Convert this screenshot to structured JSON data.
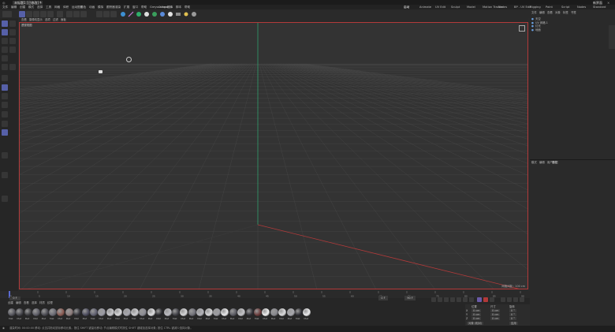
{
  "titlebar": {
    "logo": "◎",
    "doc_title": "未标题1 [已修改] *",
    "layout": "新界面"
  },
  "menu": [
    "文件",
    "编辑",
    "创建",
    "模式",
    "选择",
    "工具",
    "网格",
    "体积",
    "运动图形",
    "角色",
    "动画",
    "模拟",
    "跟踪器",
    "渲染",
    "扩展",
    "窗口",
    "帮助",
    "Greyscalegorilla",
    "Octane",
    "插件",
    "脚本",
    "帮助"
  ],
  "workspaces": [
    "启动",
    "Animate",
    "UV Edit",
    "Sculpt",
    "Model",
    "Motion Tracker",
    "Nodes",
    "BP - UV Edit",
    "Rigging",
    "Paint",
    "Script",
    "Nodes",
    "Standard"
  ],
  "viewport": {
    "name": "透视视图",
    "menu": [
      "查看",
      "摄像机",
      "显示",
      "选项",
      "过滤",
      "面板"
    ],
    "corner_text": "网格间距 : 100 cm",
    "colors": {
      "border": "#b23a3a",
      "y_axis": "#2f9e6c",
      "x_axis": "#b23a3a",
      "grid": "#4a4a4a"
    }
  },
  "object_manager": {
    "menu": [
      "文件",
      "编辑",
      "查看",
      "对象",
      "标签",
      "书签"
    ],
    "objects": [
      "天空",
      "UV 网格.1",
      "灯光",
      "地面"
    ]
  },
  "attributes": {
    "menu": [
      "模式",
      "编辑",
      "用户数据"
    ],
    "title": "属性"
  },
  "timeline": {
    "ticks": [
      "0",
      "5",
      "10",
      "15",
      "20",
      "25",
      "30",
      "35",
      "40",
      "45",
      "50",
      "55",
      "60",
      "65",
      "70",
      "75",
      "80",
      "85",
      "90"
    ],
    "current_frame": "0 F",
    "end_frame": "90 F",
    "start_field": "0 F"
  },
  "materials": {
    "menu": [
      "创建",
      "编辑",
      "查看",
      "选择",
      "材质",
      "纹理"
    ],
    "items": [
      "Mat",
      "Mat",
      "Mat",
      "Mat",
      "Mat",
      "Mat",
      "Mat",
      "Mat",
      "Mat",
      "Mat",
      "Mat",
      "Mat",
      "Mat",
      "Mat",
      "Mat",
      "Mat",
      "Mat",
      "Mat",
      "Mat",
      "Mat",
      "Mat",
      "Mat",
      "Mat",
      "Mat",
      "Mat",
      "Mat",
      "Mat",
      "Mat",
      "Mat",
      "Mat",
      "Mat",
      "Mat",
      "Mat",
      "Mat",
      "Mat",
      "Mat",
      "Mat"
    ],
    "colors": [
      "#55555c",
      "#44444a",
      "#3a3a3e",
      "#5c5c66",
      "#4a4a52",
      "#6a6a74",
      "#8a5a52",
      "#8a7a7a",
      "#33333a",
      "#4a4a5c",
      "#606070",
      "#9a9aa4",
      "#c8c8cc",
      "#dadadd",
      "#a6a6ae",
      "#cfcfd2",
      "#8c8c94",
      "#e0e0e2",
      "#2a2a2e",
      "#bcbcc2",
      "#3e3e44",
      "#d6d6d8",
      "#707078",
      "#b4b4ba",
      "#d8d8da",
      "#9c9ca2",
      "#eaeaec",
      "#5a5a62",
      "#c4c4c8",
      "#303036",
      "#6a3a3a",
      "#f0f0f0",
      "#88888e",
      "#dcdcde",
      "#a8a8ae",
      "#2e2e34",
      "#ececee"
    ]
  },
  "coords": {
    "headers": [
      "位置",
      "尺寸",
      "旋转"
    ],
    "rows": [
      [
        "X",
        "0 cm",
        "0 cm",
        "0 °"
      ],
      [
        "Y",
        "0 cm",
        "0 cm",
        "0 °"
      ],
      [
        "Z",
        "0 cm",
        "0 cm",
        "0 °"
      ]
    ],
    "mode": "对象 (相对)",
    "apply": "应用"
  },
  "status": {
    "text": "渲染时间: 00:00:00  移动: 点击并拖动鼠标移动元素。按住 SHIFT 键量化移动; 节点编辑模式时按住 SHIFT 键增加选择对象; 按住 CTRL 键减少选择对象。"
  }
}
